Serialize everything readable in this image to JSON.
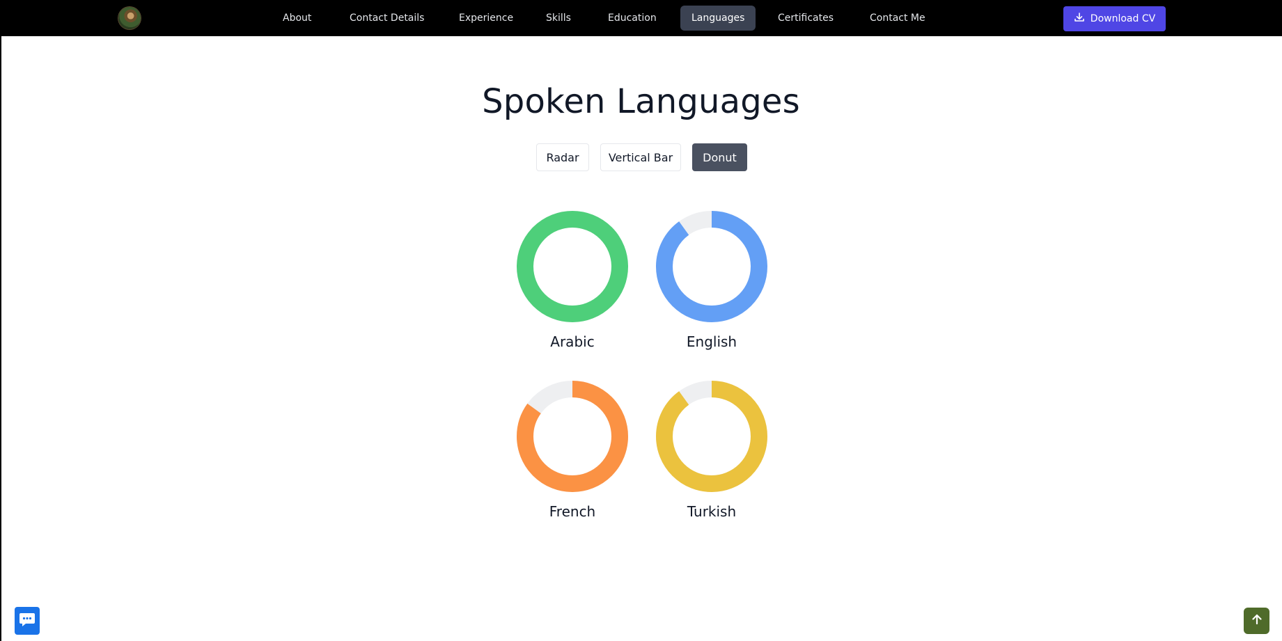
{
  "nav": {
    "links": [
      {
        "label": "About"
      },
      {
        "label": "Contact Details"
      },
      {
        "label": "Experience"
      },
      {
        "label": "Skills"
      },
      {
        "label": "Education"
      },
      {
        "label": "Languages",
        "active": true
      },
      {
        "label": "Certificates"
      },
      {
        "label": "Contact Me"
      }
    ],
    "download_label": "Download CV",
    "download_icon": "download-icon"
  },
  "main": {
    "title": "Spoken Languages",
    "toggles": [
      {
        "label": "Radar"
      },
      {
        "label": "Vertical Bar"
      },
      {
        "label": "Donut",
        "active": true
      }
    ]
  },
  "colors": {
    "arabic": "#4ecf7a",
    "english": "#639ff5",
    "french": "#fb9244",
    "turkish": "#ebc23e",
    "track": "#eeeff1",
    "accent": "#4f46e5"
  },
  "chart_data": {
    "type": "donut",
    "categories": [
      "Arabic",
      "English",
      "French",
      "Turkish"
    ],
    "values": [
      100,
      90,
      85,
      90
    ],
    "ylim": [
      0,
      100
    ]
  },
  "floating": {
    "chat_icon": "chat-icon",
    "scroll_top_icon": "arrow-up-icon"
  }
}
